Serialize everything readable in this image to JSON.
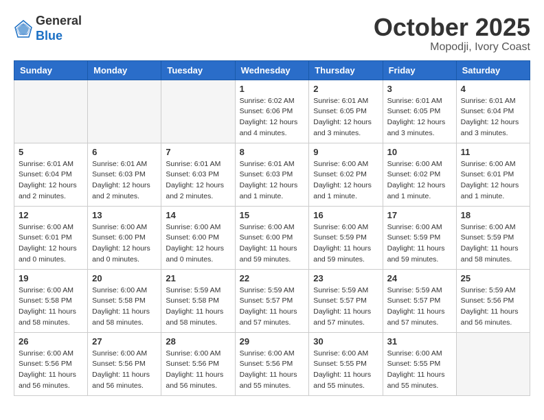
{
  "header": {
    "logo_line1": "General",
    "logo_line2": "Blue",
    "month": "October 2025",
    "location": "Mopodji, Ivory Coast"
  },
  "weekdays": [
    "Sunday",
    "Monday",
    "Tuesday",
    "Wednesday",
    "Thursday",
    "Friday",
    "Saturday"
  ],
  "weeks": [
    [
      {
        "day": "",
        "empty": true
      },
      {
        "day": "",
        "empty": true
      },
      {
        "day": "",
        "empty": true
      },
      {
        "day": "1",
        "sunrise": "6:02 AM",
        "sunset": "6:06 PM",
        "daylight": "12 hours and 4 minutes."
      },
      {
        "day": "2",
        "sunrise": "6:01 AM",
        "sunset": "6:05 PM",
        "daylight": "12 hours and 3 minutes."
      },
      {
        "day": "3",
        "sunrise": "6:01 AM",
        "sunset": "6:05 PM",
        "daylight": "12 hours and 3 minutes."
      },
      {
        "day": "4",
        "sunrise": "6:01 AM",
        "sunset": "6:04 PM",
        "daylight": "12 hours and 3 minutes."
      }
    ],
    [
      {
        "day": "5",
        "sunrise": "6:01 AM",
        "sunset": "6:04 PM",
        "daylight": "12 hours and 2 minutes."
      },
      {
        "day": "6",
        "sunrise": "6:01 AM",
        "sunset": "6:03 PM",
        "daylight": "12 hours and 2 minutes."
      },
      {
        "day": "7",
        "sunrise": "6:01 AM",
        "sunset": "6:03 PM",
        "daylight": "12 hours and 2 minutes."
      },
      {
        "day": "8",
        "sunrise": "6:01 AM",
        "sunset": "6:03 PM",
        "daylight": "12 hours and 1 minute."
      },
      {
        "day": "9",
        "sunrise": "6:00 AM",
        "sunset": "6:02 PM",
        "daylight": "12 hours and 1 minute."
      },
      {
        "day": "10",
        "sunrise": "6:00 AM",
        "sunset": "6:02 PM",
        "daylight": "12 hours and 1 minute."
      },
      {
        "day": "11",
        "sunrise": "6:00 AM",
        "sunset": "6:01 PM",
        "daylight": "12 hours and 1 minute."
      }
    ],
    [
      {
        "day": "12",
        "sunrise": "6:00 AM",
        "sunset": "6:01 PM",
        "daylight": "12 hours and 0 minutes."
      },
      {
        "day": "13",
        "sunrise": "6:00 AM",
        "sunset": "6:00 PM",
        "daylight": "12 hours and 0 minutes."
      },
      {
        "day": "14",
        "sunrise": "6:00 AM",
        "sunset": "6:00 PM",
        "daylight": "12 hours and 0 minutes."
      },
      {
        "day": "15",
        "sunrise": "6:00 AM",
        "sunset": "6:00 PM",
        "daylight": "11 hours and 59 minutes."
      },
      {
        "day": "16",
        "sunrise": "6:00 AM",
        "sunset": "5:59 PM",
        "daylight": "11 hours and 59 minutes."
      },
      {
        "day": "17",
        "sunrise": "6:00 AM",
        "sunset": "5:59 PM",
        "daylight": "11 hours and 59 minutes."
      },
      {
        "day": "18",
        "sunrise": "6:00 AM",
        "sunset": "5:59 PM",
        "daylight": "11 hours and 58 minutes."
      }
    ],
    [
      {
        "day": "19",
        "sunrise": "6:00 AM",
        "sunset": "5:58 PM",
        "daylight": "11 hours and 58 minutes."
      },
      {
        "day": "20",
        "sunrise": "6:00 AM",
        "sunset": "5:58 PM",
        "daylight": "11 hours and 58 minutes."
      },
      {
        "day": "21",
        "sunrise": "5:59 AM",
        "sunset": "5:58 PM",
        "daylight": "11 hours and 58 minutes."
      },
      {
        "day": "22",
        "sunrise": "5:59 AM",
        "sunset": "5:57 PM",
        "daylight": "11 hours and 57 minutes."
      },
      {
        "day": "23",
        "sunrise": "5:59 AM",
        "sunset": "5:57 PM",
        "daylight": "11 hours and 57 minutes."
      },
      {
        "day": "24",
        "sunrise": "5:59 AM",
        "sunset": "5:57 PM",
        "daylight": "11 hours and 57 minutes."
      },
      {
        "day": "25",
        "sunrise": "5:59 AM",
        "sunset": "5:56 PM",
        "daylight": "11 hours and 56 minutes."
      }
    ],
    [
      {
        "day": "26",
        "sunrise": "6:00 AM",
        "sunset": "5:56 PM",
        "daylight": "11 hours and 56 minutes."
      },
      {
        "day": "27",
        "sunrise": "6:00 AM",
        "sunset": "5:56 PM",
        "daylight": "11 hours and 56 minutes."
      },
      {
        "day": "28",
        "sunrise": "6:00 AM",
        "sunset": "5:56 PM",
        "daylight": "11 hours and 56 minutes."
      },
      {
        "day": "29",
        "sunrise": "6:00 AM",
        "sunset": "5:56 PM",
        "daylight": "11 hours and 55 minutes."
      },
      {
        "day": "30",
        "sunrise": "6:00 AM",
        "sunset": "5:55 PM",
        "daylight": "11 hours and 55 minutes."
      },
      {
        "day": "31",
        "sunrise": "6:00 AM",
        "sunset": "5:55 PM",
        "daylight": "11 hours and 55 minutes."
      },
      {
        "day": "",
        "empty": true
      }
    ]
  ]
}
